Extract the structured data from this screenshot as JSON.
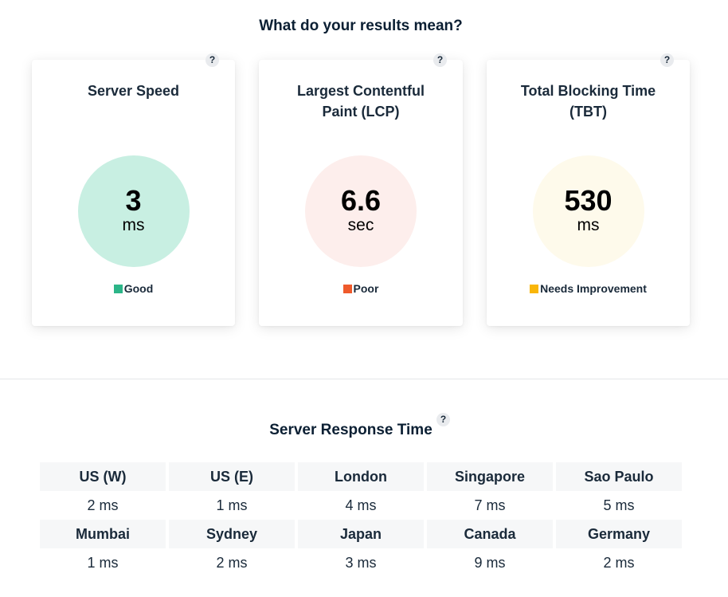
{
  "results": {
    "title": "What do your results mean?",
    "help_glyph": "?",
    "cards": [
      {
        "title": "Server Speed",
        "value": "3",
        "unit": "ms",
        "status": "Good",
        "status_color": "#2cb588",
        "gauge_color": "#c8efe2"
      },
      {
        "title": "Largest Contentful Paint (LCP)",
        "value": "6.6",
        "unit": "sec",
        "status": "Poor",
        "status_color": "#ef5a2b",
        "gauge_color": "#fdeeec"
      },
      {
        "title": "Total Blocking Time (TBT)",
        "value": "530",
        "unit": "ms",
        "status": "Needs Improvement",
        "status_color": "#f9b609",
        "gauge_color": "#fefaeb"
      }
    ]
  },
  "response": {
    "title": "Server Response Time",
    "help_glyph": "?",
    "rows": [
      {
        "names": [
          "US (W)",
          "US (E)",
          "London",
          "Singapore",
          "Sao Paulo"
        ],
        "times": [
          "2 ms",
          "1 ms",
          "4 ms",
          "7 ms",
          "5 ms"
        ]
      },
      {
        "names": [
          "Mumbai",
          "Sydney",
          "Japan",
          "Canada",
          "Germany"
        ],
        "times": [
          "1 ms",
          "2 ms",
          "3 ms",
          "9 ms",
          "2 ms"
        ]
      }
    ]
  },
  "icons": {
    "help": "question-mark-icon"
  }
}
